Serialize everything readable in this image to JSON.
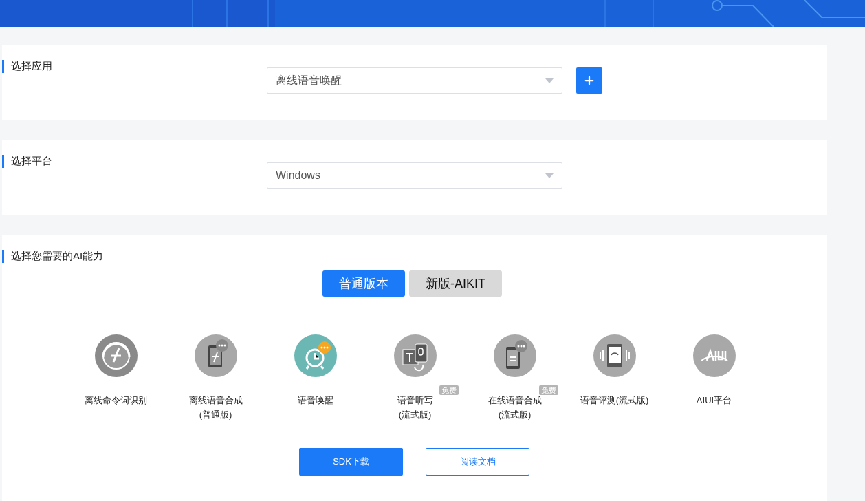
{
  "app_section": {
    "title": "选择应用",
    "select_value": "离线语音唤醒"
  },
  "platform_section": {
    "title": "选择平台",
    "select_value": "Windows"
  },
  "ability_section": {
    "title": "选择您需要的AI能力",
    "tabs": [
      {
        "label": "普通版本",
        "selected": true
      },
      {
        "label": "新版-AIKIT",
        "selected": false
      }
    ],
    "abilities": [
      {
        "kind": "headset",
        "lines": [
          "离线命令词识别"
        ],
        "selected": false
      },
      {
        "kind": "phone",
        "lines": [
          "离线语音合成",
          "(普通版)"
        ],
        "selected": false
      },
      {
        "kind": "alarm",
        "lines": [
          "语音唤醒"
        ],
        "selected": true
      },
      {
        "kind": "dictation",
        "lines": [
          "语音听写",
          "(流式版)"
        ],
        "badge": "免费",
        "selected": false
      },
      {
        "kind": "chat",
        "lines": [
          "在线语音合成",
          "(流式版)"
        ],
        "badge": "免费",
        "selected": false
      },
      {
        "kind": "meter",
        "lines": [
          "语音评测(流式版)"
        ],
        "selected": false
      },
      {
        "kind": "aiui",
        "lines": [
          "AIUI平台"
        ],
        "selected": false
      }
    ],
    "buttons": [
      {
        "label": "SDK下载",
        "kind": "primary"
      },
      {
        "label": "阅读文档",
        "kind": "outline"
      }
    ]
  }
}
